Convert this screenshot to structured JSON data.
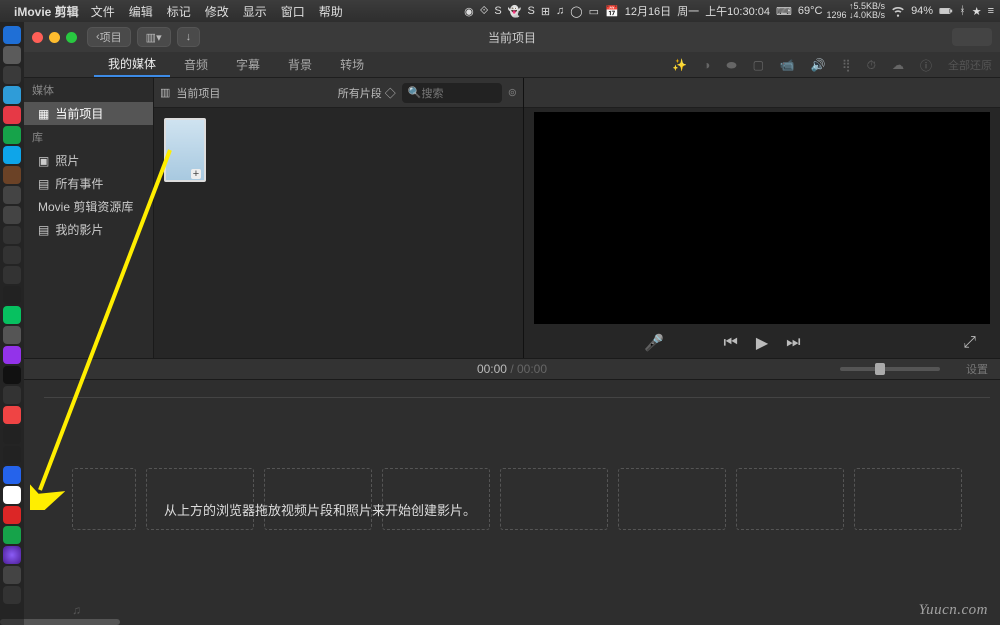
{
  "menubar": {
    "app": "iMovie 剪辑",
    "items": [
      "文件",
      "编辑",
      "标记",
      "修改",
      "显示",
      "窗口",
      "帮助"
    ],
    "date": "12月16日",
    "weekday": "周一",
    "time": "上午10:30:04",
    "temp": "69°C",
    "net_up": "5.5KB/s",
    "net_down": "4.0KB/s",
    "cpu": "1296",
    "battery": "94%"
  },
  "titlebar": {
    "back": "项目",
    "title": "当前项目"
  },
  "tabs": {
    "items": [
      "我的媒体",
      "音频",
      "字幕",
      "背景",
      "转场"
    ],
    "active_index": 0,
    "enhance_label": "全部还原"
  },
  "sidebar": {
    "header_media": "媒体",
    "items": [
      {
        "label": "当前项目",
        "selected": true
      },
      {
        "label": "库",
        "header": false
      },
      {
        "label": "照片"
      },
      {
        "label": "所有事件"
      },
      {
        "label": "Movie 剪辑资源库"
      },
      {
        "label": "我的影片"
      }
    ],
    "header_lib": "库"
  },
  "browser": {
    "title": "当前项目",
    "filter": "所有片段",
    "search_placeholder": "搜索"
  },
  "transport": {
    "time_current": "00:00",
    "time_total": "00:00"
  },
  "timeline": {
    "hint": "从上方的浏览器拖放视频片段和照片来开始创建影片。",
    "settings": "设置"
  },
  "watermark": "Yuucn.com",
  "colors": {
    "close": "#ff5f57",
    "min": "#febc2e",
    "max": "#28c840",
    "arrow": "#ffee00"
  }
}
